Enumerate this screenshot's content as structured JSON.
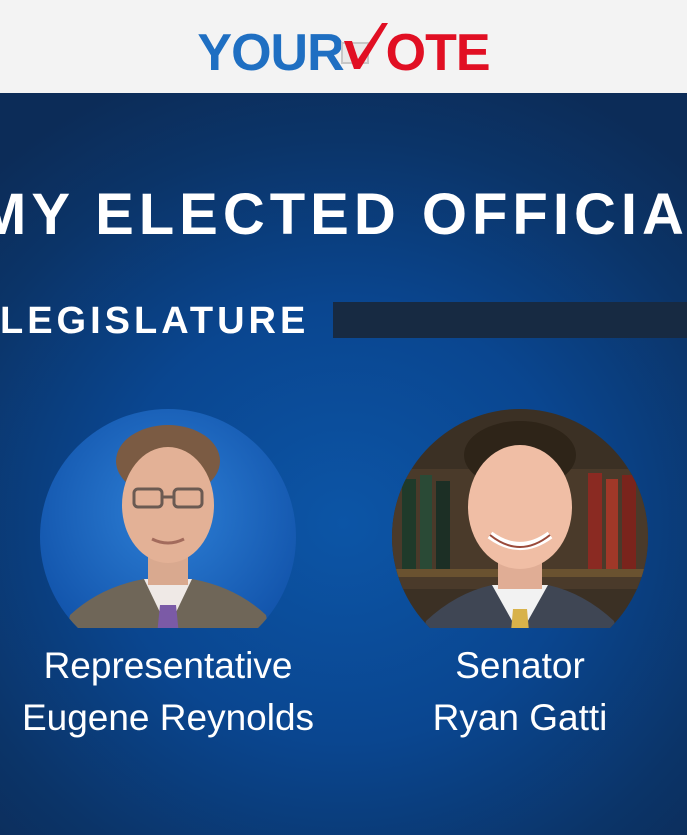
{
  "header": {
    "logo": {
      "part1": "YOUR",
      "part2": "OTE",
      "text": "YOURVOTE",
      "colors": {
        "your": "#1f6fc2",
        "vote": "#e10f23"
      }
    }
  },
  "page": {
    "title": "MY ELECTED OFFICIALS",
    "background": "#0a4690"
  },
  "section": {
    "label": "LEGISLATURE",
    "bar_color": "#172a42"
  },
  "officials": [
    {
      "title": "Representative",
      "name": "Eugene Reynolds",
      "photo": "portrait-photo"
    },
    {
      "title": "Senator",
      "name": "Ryan Gatti",
      "photo": "portrait-photo"
    }
  ]
}
